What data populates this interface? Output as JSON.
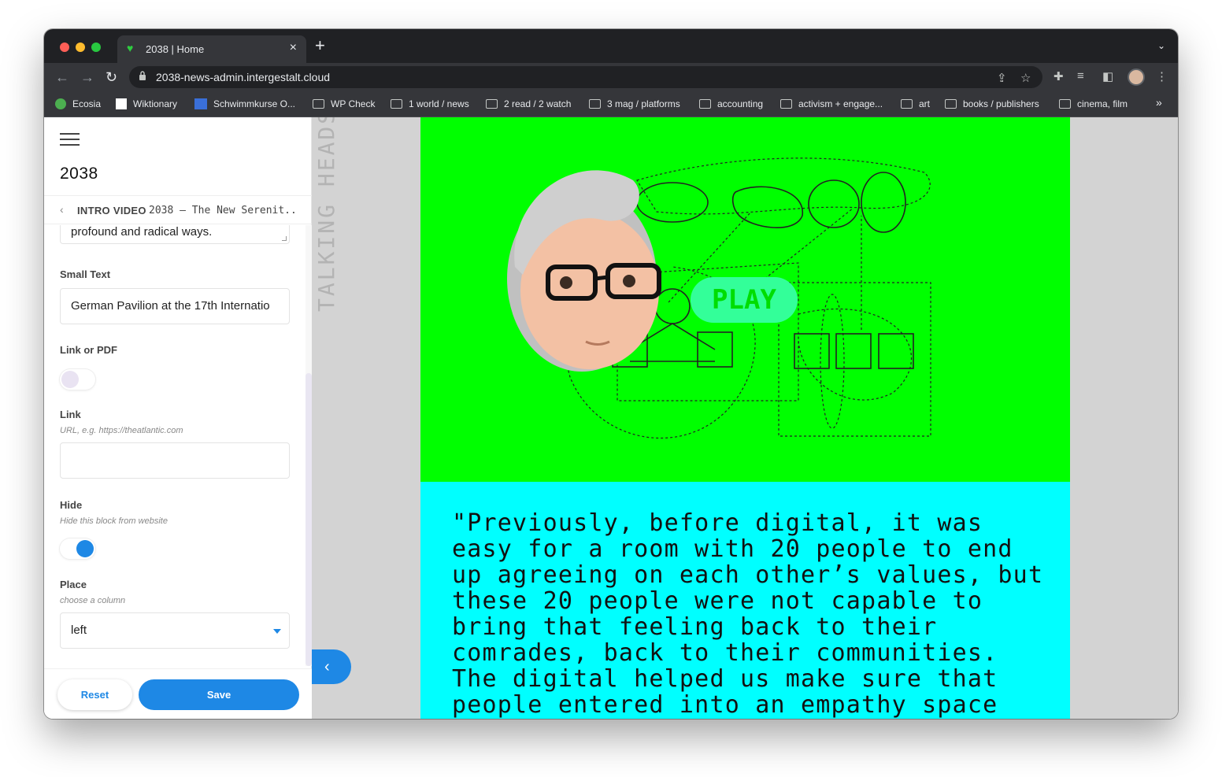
{
  "browser": {
    "tab_title": "2038 | Home",
    "tab_favicon": "green-heart-icon",
    "url": "2038-news-admin.intergestalt.cloud",
    "bookmarks": [
      {
        "label": "Ecosia",
        "icon": "ecosia-icon"
      },
      {
        "label": "Wiktionary",
        "icon": "wiktionary-icon"
      },
      {
        "label": "Schwimmkurse O...",
        "icon": "swim-icon"
      },
      {
        "label": "WP Check",
        "icon": "folder-icon"
      },
      {
        "label": "1 world / news",
        "icon": "folder-icon"
      },
      {
        "label": "2 read / 2 watch",
        "icon": "folder-icon"
      },
      {
        "label": "3 mag / platforms",
        "icon": "folder-icon"
      },
      {
        "label": "accounting",
        "icon": "folder-icon"
      },
      {
        "label": "activism + engage...",
        "icon": "folder-icon"
      },
      {
        "label": "art",
        "icon": "folder-icon"
      },
      {
        "label": "books / publishers",
        "icon": "folder-icon"
      },
      {
        "label": "cinema, film",
        "icon": "folder-icon"
      }
    ],
    "overflow": "»"
  },
  "panel": {
    "site_title": "2038",
    "breadcrumb": {
      "kind": "INTRO VIDEO",
      "name": "2038 – The New Serenit..."
    },
    "textarea_tail": "profound and radical ways.",
    "small_text": {
      "label": "Small Text",
      "value": "German Pavilion at the 17th Internatio"
    },
    "link_or_pdf": {
      "label": "Link or PDF",
      "on": false
    },
    "link": {
      "label": "Link",
      "help": "URL, e.g. https://theatlantic.com",
      "value": ""
    },
    "hide": {
      "label": "Hide",
      "help": "Hide this block from website",
      "on": true
    },
    "place": {
      "label": "Place",
      "help": "choose a column",
      "value": "left"
    },
    "reset_label": "Reset",
    "save_label": "Save"
  },
  "preview": {
    "vertical_label": "TALKING HEADS",
    "play_label": "PLAY",
    "quote": "\"Previously, before digital, it was easy for a room with 20 people to end up agreeing on each other’s values, but these 20 people were not capable to bring that feeling back to their comrades, back to their communities. The digital helped us make sure that people entered into an empathy space",
    "colors": {
      "hero_bg": "#00ff00",
      "quote_bg": "#00ffff",
      "accent": "#1e88e5"
    }
  }
}
